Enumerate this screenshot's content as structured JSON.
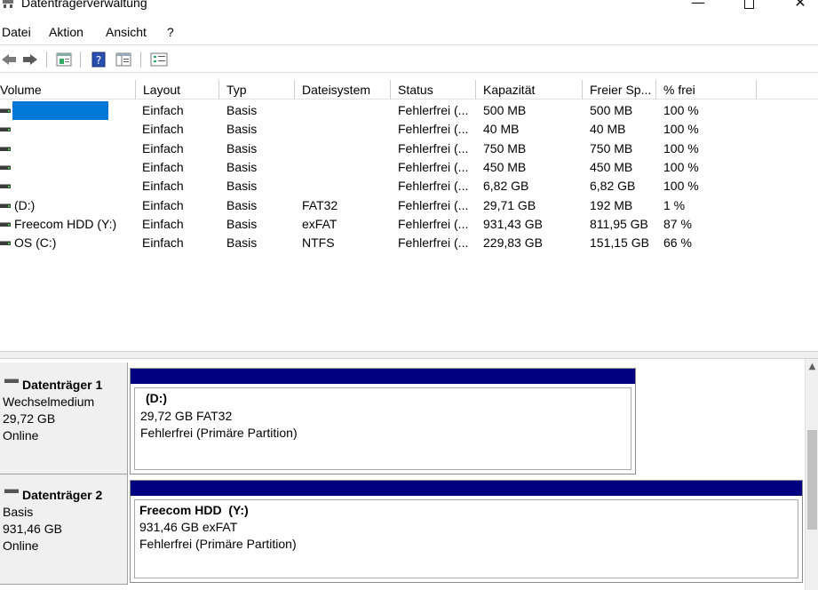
{
  "window": {
    "title": "Datenträgerverwaltung",
    "controls": {
      "minimize": "—",
      "close": "✕"
    }
  },
  "menu": [
    "Datei",
    "Aktion",
    "Ansicht",
    "?"
  ],
  "toolbar": [
    "back",
    "forward",
    "properties",
    "help",
    "show-hide-pane",
    "settings"
  ],
  "volume_list": {
    "columns": [
      "Volume",
      "Layout",
      "Typ",
      "Dateisystem",
      "Status",
      "Kapazität",
      "Freier Sp...",
      "% frei"
    ],
    "rows": [
      {
        "volume": "",
        "selected": true,
        "layout": "Einfach",
        "typ": "Basis",
        "fs": "",
        "status": "Fehlerfrei (...",
        "capacity": "500 MB",
        "free": "500 MB",
        "pct": "100 %"
      },
      {
        "volume": "",
        "layout": "Einfach",
        "typ": "Basis",
        "fs": "",
        "status": "Fehlerfrei (...",
        "capacity": "40 MB",
        "free": "40 MB",
        "pct": "100 %"
      },
      {
        "volume": "",
        "layout": "Einfach",
        "typ": "Basis",
        "fs": "",
        "status": "Fehlerfrei (...",
        "capacity": "750 MB",
        "free": "750 MB",
        "pct": "100 %"
      },
      {
        "volume": "",
        "layout": "Einfach",
        "typ": "Basis",
        "fs": "",
        "status": "Fehlerfrei (...",
        "capacity": "450 MB",
        "free": "450 MB",
        "pct": "100 %"
      },
      {
        "volume": "",
        "layout": "Einfach",
        "typ": "Basis",
        "fs": "",
        "status": "Fehlerfrei (...",
        "capacity": "6,82 GB",
        "free": "6,82 GB",
        "pct": "100 %"
      },
      {
        "volume": "(D:)",
        "layout": "Einfach",
        "typ": "Basis",
        "fs": "FAT32",
        "status": "Fehlerfrei (...",
        "capacity": "29,71 GB",
        "free": "192 MB",
        "pct": "1 %"
      },
      {
        "volume": "Freecom HDD (Y:)",
        "layout": "Einfach",
        "typ": "Basis",
        "fs": "exFAT",
        "status": "Fehlerfrei (...",
        "capacity": "931,43 GB",
        "free": "811,95 GB",
        "pct": "87 %"
      },
      {
        "volume": "OS (C:)",
        "layout": "Einfach",
        "typ": "Basis",
        "fs": "NTFS",
        "status": "Fehlerfrei (...",
        "capacity": "229,83 GB",
        "free": "151,15 GB",
        "pct": "66 %"
      }
    ]
  },
  "disks": [
    {
      "title": "Datenträger 1",
      "type": "Wechselmedium",
      "size": "29,72 GB",
      "state": "Online",
      "partition": {
        "name": "(D:)",
        "size_fs": "29,72 GB FAT32",
        "status": "Fehlerfrei (Primäre Partition)"
      }
    },
    {
      "title": "Datenträger 2",
      "type": "Basis",
      "size": "931,46 GB",
      "state": "Online",
      "partition": {
        "name": "Freecom HDD  (Y:)",
        "size_fs": "931,46 GB exFAT",
        "status": "Fehlerfrei (Primäre Partition)"
      }
    }
  ],
  "colors": {
    "partition_header": "#000080",
    "selection": "#0078d7",
    "panel": "#f0f0f0"
  }
}
